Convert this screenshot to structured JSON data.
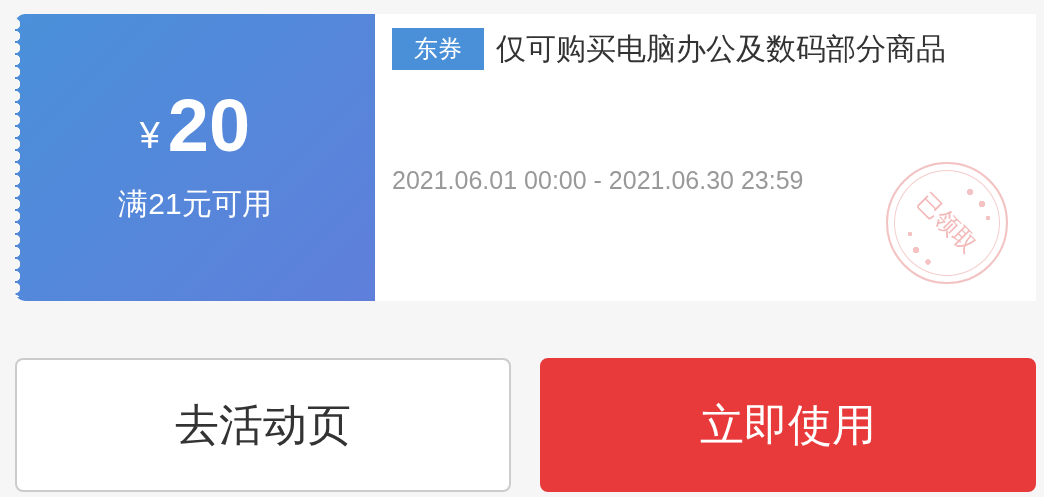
{
  "coupon": {
    "currency": "¥",
    "amount": "20",
    "condition": "满21元可用",
    "tag": "东券",
    "title": "仅可购买电脑办公及数码部分商品",
    "validity": "2021.06.01 00:00 - 2021.06.30 23:59",
    "claimed": true,
    "stamp_text": "已领取"
  },
  "buttons": [
    {
      "label": "去活动页",
      "kind": "secondary"
    },
    {
      "label": "立即使用",
      "kind": "primary"
    }
  ]
}
